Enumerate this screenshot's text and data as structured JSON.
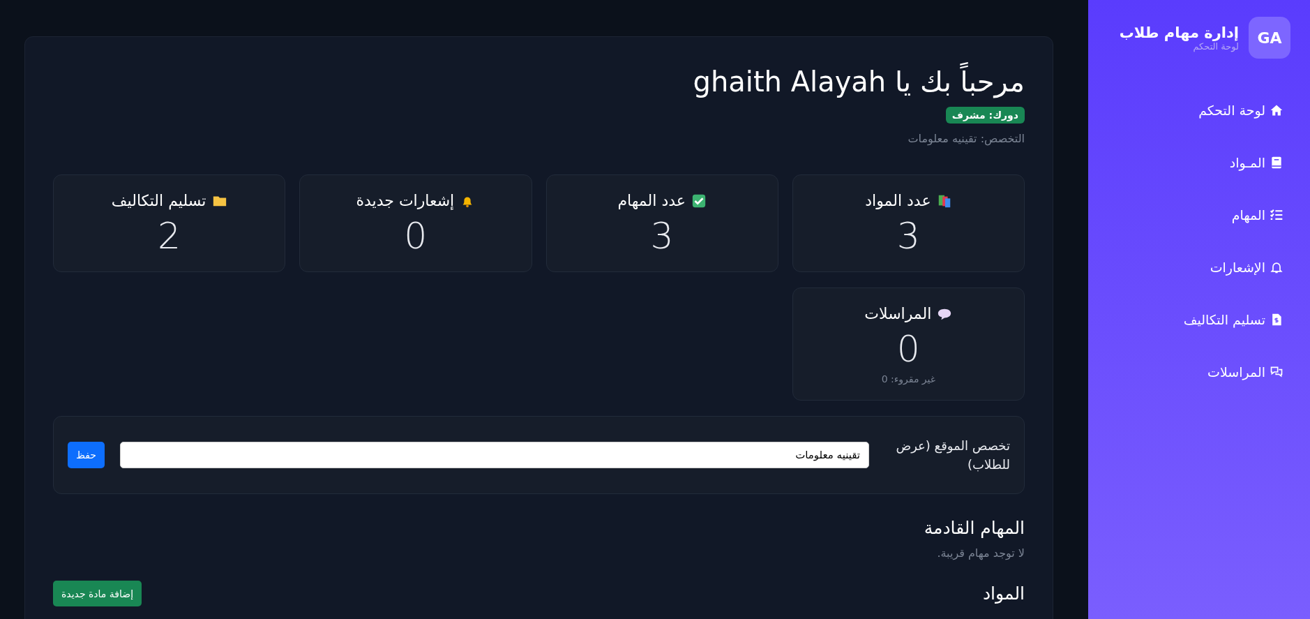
{
  "sidebar": {
    "avatar": "GA",
    "title": "إدارة مهام طلاب",
    "subtitle": "لوحة التحكم",
    "items": [
      {
        "label": "لوحة التحكم"
      },
      {
        "label": "المـواد"
      },
      {
        "label": "المهام"
      },
      {
        "label": "الإشعارات"
      },
      {
        "label": "تسليم التكاليف"
      },
      {
        "label": "المراسلات"
      }
    ]
  },
  "header": {
    "greeting": "مرحباً بك يا ghaith Alayah",
    "role_badge": "دورك: مشرف",
    "specialty": "التخصص: تقينيه معلومات"
  },
  "stats": [
    {
      "label": "عدد المواد",
      "value": "3"
    },
    {
      "label": "عدد المهام",
      "value": "3"
    },
    {
      "label": "إشعارات جديدة",
      "value": "0"
    },
    {
      "label": "تسليم التكاليف",
      "value": "2"
    },
    {
      "label": "المراسلات",
      "value": "0",
      "note": "غير مقروء: 0"
    }
  ],
  "specialty_form": {
    "label": "تخصص الموقع (عرض للطلاب)",
    "value": "تقينيه معلومات",
    "button": "حفظ"
  },
  "upcoming": {
    "title": "المهام القادمة",
    "empty_text": "لا توجد مهام قريبة."
  },
  "materials": {
    "title": "المواد",
    "button": "إضافة مادة جديدة"
  }
}
